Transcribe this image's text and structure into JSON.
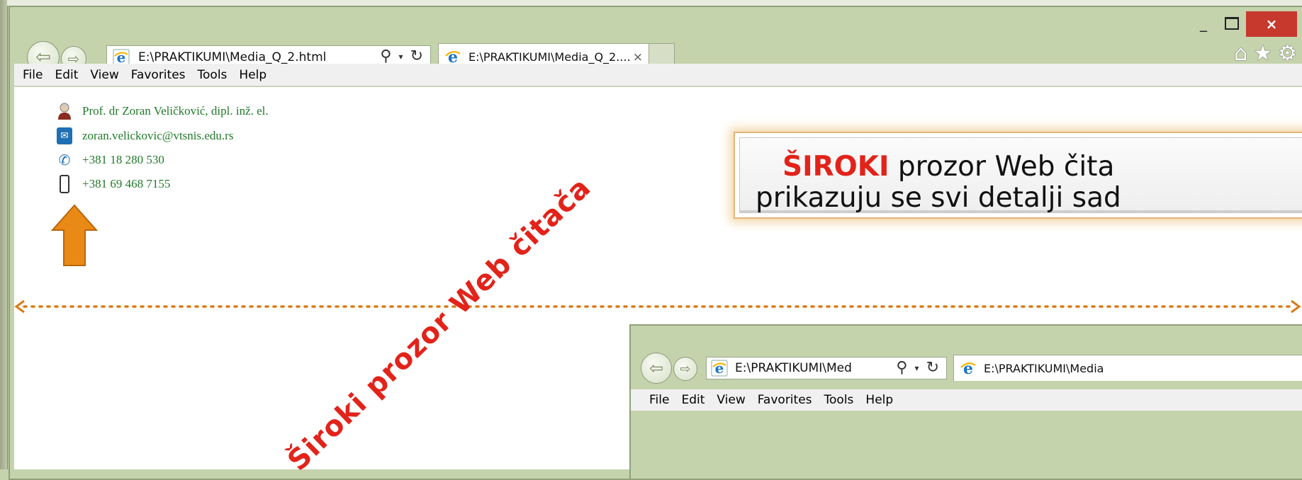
{
  "browser": {
    "address": "E:\\PRAKTIKUMI\\Media_Q_2.html",
    "tab_title": "E:\\PRAKTIKUMI\\Media_Q_2....",
    "tab_close": "×",
    "caption": {
      "minimize": "_",
      "close": "×"
    },
    "icons": [
      "back-arrow-icon",
      "forward-arrow-icon",
      "ie-icon",
      "search-icon",
      "refresh-icon",
      "home-icon",
      "favorites-star-icon",
      "gear-icon"
    ]
  },
  "menu": [
    "File",
    "Edit",
    "View",
    "Favorites",
    "Tools",
    "Help"
  ],
  "contacts": [
    {
      "icon": "person-icon",
      "text": "Prof. dr Zoran Veličković, dipl. inž. el."
    },
    {
      "icon": "mail-icon",
      "text": "zoran.velickovic@vtsnis.edu.rs"
    },
    {
      "icon": "phone-icon",
      "text": "+381 18 280 530"
    },
    {
      "icon": "mobile-phone-icon",
      "text": "+381 69 468 7155"
    }
  ],
  "diagonal_label": "Široki prozor Web čitača",
  "callout": {
    "highlight": "ŠIROKI",
    "line1_rest": " prozor Web čita",
    "line2": "prikazuju se svi detalji sad"
  },
  "small_browser": {
    "address": "E:\\PRAKTIKUMI\\Med",
    "tab_title": "E:\\PRAKTIKUMI\\Media",
    "menu": [
      "File",
      "Edit",
      "View",
      "Favorites",
      "Tools",
      "Help"
    ]
  },
  "colors": {
    "accent_red": "#e2231a",
    "arrow_orange": "#e98a16",
    "contact_green": "#227a2a",
    "chrome": "#c5d3ad"
  }
}
